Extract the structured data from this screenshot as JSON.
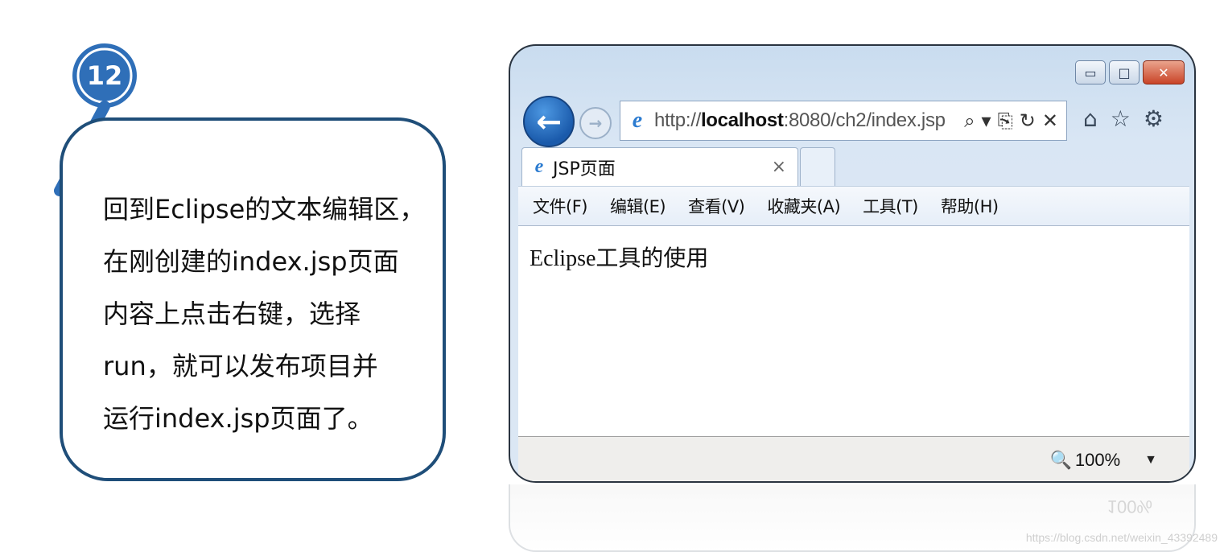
{
  "step": {
    "number": "12",
    "color": "#2f6fb8"
  },
  "instruction": {
    "text": "回到Eclipse的文本编辑区，\n在刚创建的index.jsp页面\n内容上点击右键，选择\nrun，就可以发布项目并\n运行index.jsp页面了。"
  },
  "browser": {
    "window_buttons": {
      "minimize": "▭",
      "maximize": "□",
      "close": "✕"
    },
    "nav": {
      "back_icon": "←",
      "forward_icon": "→"
    },
    "address": {
      "prefix": "http://",
      "host": "localhost",
      "rest": ":8080/ch2/index.jsp",
      "tools": [
        "⌕",
        "▾",
        "⎘",
        "↻",
        "✕"
      ]
    },
    "toolbar_icons": [
      "⌂",
      "☆",
      "⚙"
    ],
    "tab": {
      "title": "JSP页面",
      "close": "×"
    },
    "menu": [
      "文件(F)",
      "编辑(E)",
      "查看(V)",
      "收藏夹(A)",
      "工具(T)",
      "帮助(H)"
    ],
    "page_content": "Eclipse工具的使用",
    "status": {
      "zoom": "100%",
      "zoom_icon": "🔍",
      "dropdown": "▼"
    }
  },
  "reflection": {
    "zoom": "100%"
  },
  "watermark": "https://blog.csdn.net/weixin_43392489",
  "colors": {
    "accent": "#1f4e79",
    "key": "#2f6fb8",
    "window_frame": "#c9dcef"
  }
}
